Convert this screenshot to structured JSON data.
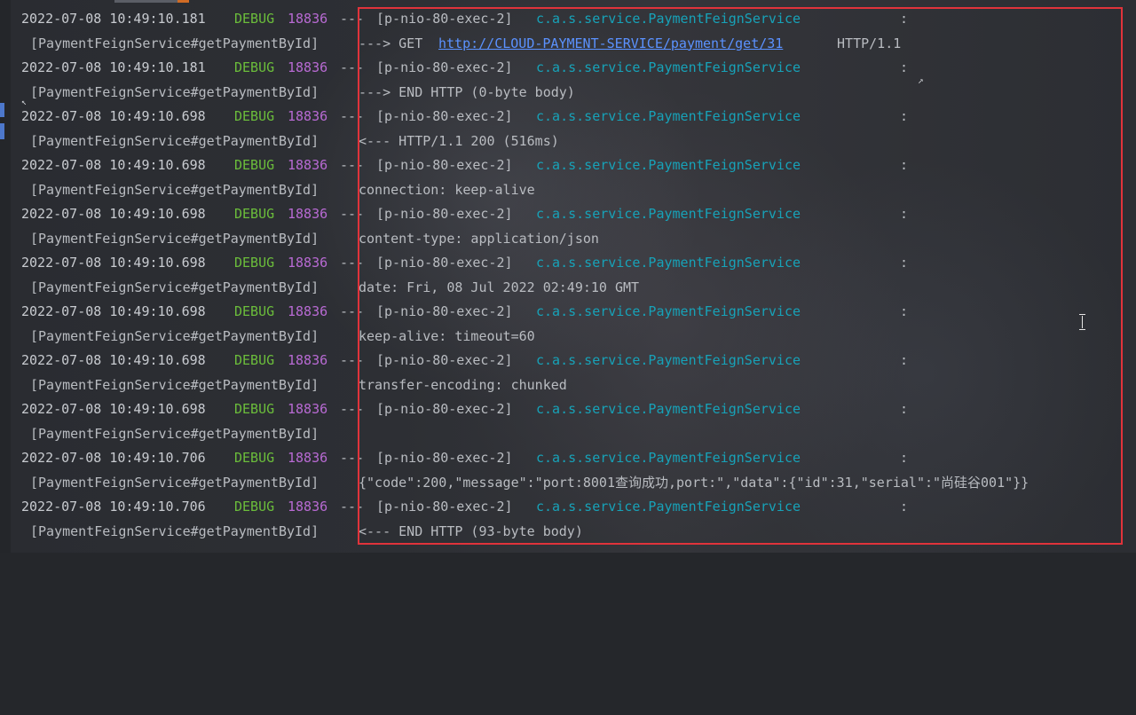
{
  "log": {
    "entries": [
      {
        "timestamp": "2022-07-08 10:49:10.181",
        "level": "DEBUG",
        "pid": "18836",
        "separator": "---",
        "thread": "[p-nio-80-exec-2]",
        "logger": "c.a.s.service.PaymentFeignService",
        "colon": ":",
        "method": "[PaymentFeignService#getPaymentById]",
        "message_pre": "---> GET ",
        "message_link": "http://CLOUD-PAYMENT-SERVICE/payment/get/31",
        "message_post": " HTTP/1.1"
      },
      {
        "timestamp": "2022-07-08 10:49:10.181",
        "level": "DEBUG",
        "pid": "18836",
        "separator": "---",
        "thread": "[p-nio-80-exec-2]",
        "logger": "c.a.s.service.PaymentFeignService",
        "colon": ":",
        "method": "[PaymentFeignService#getPaymentById]",
        "message": "---> END HTTP (0-byte body)"
      },
      {
        "timestamp": "2022-07-08 10:49:10.698",
        "level": "DEBUG",
        "pid": "18836",
        "separator": "---",
        "thread": "[p-nio-80-exec-2]",
        "logger": "c.a.s.service.PaymentFeignService",
        "colon": ":",
        "method": "[PaymentFeignService#getPaymentById]",
        "message": "<--- HTTP/1.1 200 (516ms)"
      },
      {
        "timestamp": "2022-07-08 10:49:10.698",
        "level": "DEBUG",
        "pid": "18836",
        "separator": "---",
        "thread": "[p-nio-80-exec-2]",
        "logger": "c.a.s.service.PaymentFeignService",
        "colon": ":",
        "method": "[PaymentFeignService#getPaymentById]",
        "message": "connection: keep-alive"
      },
      {
        "timestamp": "2022-07-08 10:49:10.698",
        "level": "DEBUG",
        "pid": "18836",
        "separator": "---",
        "thread": "[p-nio-80-exec-2]",
        "logger": "c.a.s.service.PaymentFeignService",
        "colon": ":",
        "method": "[PaymentFeignService#getPaymentById]",
        "message": "content-type: application/json"
      },
      {
        "timestamp": "2022-07-08 10:49:10.698",
        "level": "DEBUG",
        "pid": "18836",
        "separator": "---",
        "thread": "[p-nio-80-exec-2]",
        "logger": "c.a.s.service.PaymentFeignService",
        "colon": ":",
        "method": "[PaymentFeignService#getPaymentById]",
        "message": "date: Fri, 08 Jul 2022 02:49:10 GMT"
      },
      {
        "timestamp": "2022-07-08 10:49:10.698",
        "level": "DEBUG",
        "pid": "18836",
        "separator": "---",
        "thread": "[p-nio-80-exec-2]",
        "logger": "c.a.s.service.PaymentFeignService",
        "colon": ":",
        "method": "[PaymentFeignService#getPaymentById]",
        "message": "keep-alive: timeout=60"
      },
      {
        "timestamp": "2022-07-08 10:49:10.698",
        "level": "DEBUG",
        "pid": "18836",
        "separator": "---",
        "thread": "[p-nio-80-exec-2]",
        "logger": "c.a.s.service.PaymentFeignService",
        "colon": ":",
        "method": "[PaymentFeignService#getPaymentById]",
        "message": "transfer-encoding: chunked"
      },
      {
        "timestamp": "2022-07-08 10:49:10.698",
        "level": "DEBUG",
        "pid": "18836",
        "separator": "---",
        "thread": "[p-nio-80-exec-2]",
        "logger": "c.a.s.service.PaymentFeignService",
        "colon": ":",
        "method": "[PaymentFeignService#getPaymentById]",
        "message": ""
      },
      {
        "timestamp": "2022-07-08 10:49:10.706",
        "level": "DEBUG",
        "pid": "18836",
        "separator": "---",
        "thread": "[p-nio-80-exec-2]",
        "logger": "c.a.s.service.PaymentFeignService",
        "colon": ":",
        "method": "[PaymentFeignService#getPaymentById]",
        "message": "{\"code\":200,\"message\":\"port:8001查询成功,port:\",\"data\":{\"id\":31,\"serial\":\"尚硅谷001\"}}"
      },
      {
        "timestamp": "2022-07-08 10:49:10.706",
        "level": "DEBUG",
        "pid": "18836",
        "separator": "---",
        "thread": "[p-nio-80-exec-2]",
        "logger": "c.a.s.service.PaymentFeignService",
        "colon": ":",
        "method": "[PaymentFeignService#getPaymentById]",
        "message": "<--- END HTTP (93-byte body)"
      }
    ]
  },
  "colors": {
    "background": "#25272b",
    "text": "#b9bcc1",
    "debug": "#6bbd3b",
    "pid": "#b86ad3",
    "logger": "#17a2b8",
    "link": "#5b92ff",
    "highlight_box": "#e0333b",
    "gutter_marker": "#4d78cc"
  },
  "icons": {
    "edit_mark": "↗",
    "caret_mark": "↖"
  }
}
